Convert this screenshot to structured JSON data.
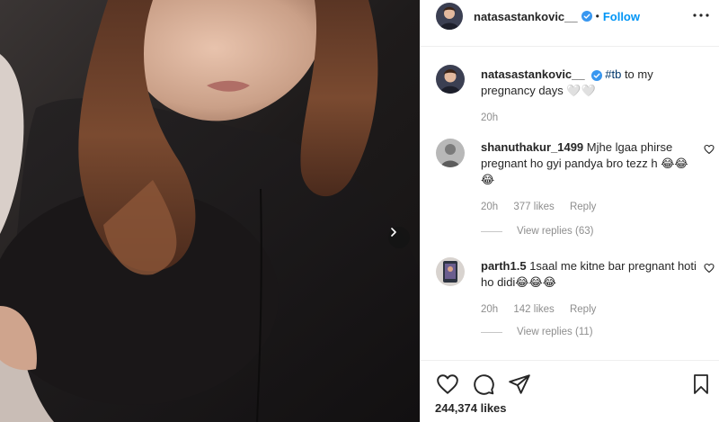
{
  "post": {
    "username": "natasastankovic__",
    "separator": "•",
    "follow_label": "Follow",
    "more_label": "···"
  },
  "caption": {
    "username": "natasastankovic__",
    "hashtag": "#tb",
    "text": " to my pregnancy days 🤍🤍",
    "time": "20h"
  },
  "comments": [
    {
      "username": "shanuthakur_1499",
      "text": " Mjhe lgaa phirse pregnant ho gyi pandya bro tezz h 😂😂😂",
      "time": "20h",
      "likes": "377 likes",
      "reply_label": "Reply",
      "view_replies": "View replies (63)"
    },
    {
      "username": "parth1.5",
      "text": " 1saal me kitne bar pregnant hoti ho didi😂😂😂",
      "time": "20h",
      "likes": "142 likes",
      "reply_label": "Reply",
      "view_replies": "View replies (11)"
    }
  ],
  "footer": {
    "likes": "244,374 likes"
  },
  "icons": {
    "like": "heart-icon",
    "comment": "comment-icon",
    "share": "paper-plane-icon",
    "save": "bookmark-icon",
    "next": "chevron-right-icon",
    "verified": "verified-badge-icon",
    "more": "more-options-icon"
  },
  "colors": {
    "accent": "#0095f6",
    "text": "#262626",
    "muted": "#8e8e8e",
    "divider": "#efefef",
    "hashtag": "#00376b"
  }
}
